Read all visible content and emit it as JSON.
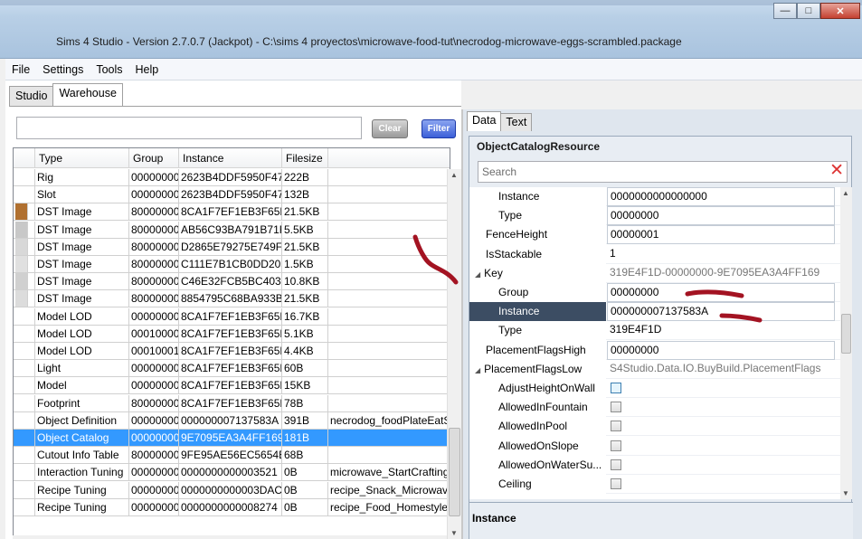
{
  "window": {
    "title": "Sims 4 Studio - Version 2.7.0.7  (Jackpot)   - C:\\sims 4 proyectos\\microwave-food-tut\\necrodog-microwave-eggs-scrambled.package"
  },
  "menu": [
    "File",
    "Settings",
    "Tools",
    "Help"
  ],
  "left_tabs": [
    "Studio",
    "Warehouse"
  ],
  "search": {
    "value": "",
    "clear_label": "Clear",
    "filter_label": "Filter"
  },
  "grid": {
    "columns": [
      "Type",
      "Group",
      "Instance",
      "Filesize"
    ],
    "rows": [
      {
        "type": "Rig",
        "group": "00000000",
        "instance": "2623B4DDF5950F47",
        "size": "222B",
        "name": ""
      },
      {
        "type": "Slot",
        "group": "00000000",
        "instance": "2623B4DDF5950F47",
        "size": "132B",
        "name": ""
      },
      {
        "type": "DST Image",
        "group": "80000000",
        "instance": "8CA1F7EF1EB3F65D",
        "size": "21.5KB",
        "name": ""
      },
      {
        "type": "DST Image",
        "group": "80000000",
        "instance": "AB56C93BA791B71F",
        "size": "5.5KB",
        "name": ""
      },
      {
        "type": "DST Image",
        "group": "80000000",
        "instance": "D2865E79275E749F",
        "size": "21.5KB",
        "name": ""
      },
      {
        "type": "DST Image",
        "group": "80000000",
        "instance": "C111E7B1CB0DD205",
        "size": "1.5KB",
        "name": ""
      },
      {
        "type": "DST Image",
        "group": "80000000",
        "instance": "C46E32FCB5BC403B",
        "size": "10.8KB",
        "name": ""
      },
      {
        "type": "DST Image",
        "group": "80000000",
        "instance": "8854795C68BA933B",
        "size": "21.5KB",
        "name": ""
      },
      {
        "type": "Model LOD",
        "group": "00000000",
        "instance": "8CA1F7EF1EB3F65D",
        "size": "16.7KB",
        "name": ""
      },
      {
        "type": "Model LOD",
        "group": "00010000",
        "instance": "8CA1F7EF1EB3F65D",
        "size": "5.1KB",
        "name": ""
      },
      {
        "type": "Model LOD",
        "group": "00010001",
        "instance": "8CA1F7EF1EB3F65D",
        "size": "4.4KB",
        "name": ""
      },
      {
        "type": "Light",
        "group": "00000000",
        "instance": "8CA1F7EF1EB3F65D",
        "size": "60B",
        "name": ""
      },
      {
        "type": "Model",
        "group": "00000000",
        "instance": "8CA1F7EF1EB3F65D",
        "size": "15KB",
        "name": ""
      },
      {
        "type": "Footprint",
        "group": "80000000",
        "instance": "8CA1F7EF1EB3F65D",
        "size": "78B",
        "name": ""
      },
      {
        "type": "Object Definition",
        "group": "00000000",
        "instance": "000000007137583A",
        "size": "391B",
        "name": "necrodog_foodPlateEatSin"
      },
      {
        "type": "Object Catalog",
        "group": "00000000",
        "instance": "9E7095EA3A4FF169",
        "size": "181B",
        "name": ""
      },
      {
        "type": "Cutout Info Table",
        "group": "80000000",
        "instance": "9FE95AE56EC5654E",
        "size": "68B",
        "name": ""
      },
      {
        "type": "Interaction Tuning",
        "group": "00000000",
        "instance": "0000000000003521",
        "size": "0B",
        "name": "microwave_StartCrafting"
      },
      {
        "type": "Recipe Tuning",
        "group": "00000000",
        "instance": "0000000000003DAC",
        "size": "0B",
        "name": "recipe_Snack_MicrowaveP"
      },
      {
        "type": "Recipe Tuning",
        "group": "00000000",
        "instance": "0000000000008274",
        "size": "0B",
        "name": "recipe_Food_Homestyle_S"
      }
    ]
  },
  "right_tabs": [
    "Data",
    "Text"
  ],
  "resource": {
    "heading": "ObjectCatalogResource",
    "search_placeholder": "Search",
    "props": [
      {
        "name": "Instance",
        "indent": 2,
        "value": "0000000000000000",
        "kind": "edit"
      },
      {
        "name": "Type",
        "indent": 2,
        "value": "00000000",
        "kind": "edit"
      },
      {
        "name": "FenceHeight",
        "indent": 1,
        "value": "00000001",
        "kind": "edit"
      },
      {
        "name": "IsStackable",
        "indent": 1,
        "value": "1",
        "kind": "text"
      },
      {
        "name": "Key",
        "indent": 0,
        "value": "319E4F1D-00000000-9E7095EA3A4FF169",
        "kind": "grey"
      },
      {
        "name": "Group",
        "indent": 2,
        "value": "00000000",
        "kind": "edit"
      },
      {
        "name": "Instance",
        "indent": 2,
        "value": "000000007137583A",
        "kind": "edit",
        "selected": true
      },
      {
        "name": "Type",
        "indent": 2,
        "value": "319E4F1D",
        "kind": "text"
      },
      {
        "name": "PlacementFlagsHigh",
        "indent": 1,
        "value": "00000000",
        "kind": "edit"
      },
      {
        "name": "PlacementFlagsLow",
        "indent": 0,
        "value": "S4Studio.Data.IO.BuyBuild.PlacementFlags",
        "kind": "grey"
      },
      {
        "name": "AdjustHeightOnWall",
        "indent": 2,
        "value": "",
        "kind": "check-focus"
      },
      {
        "name": "AllowedInFountain",
        "indent": 2,
        "value": "",
        "kind": "check"
      },
      {
        "name": "AllowedInPool",
        "indent": 2,
        "value": "",
        "kind": "check"
      },
      {
        "name": "AllowedOnSlope",
        "indent": 2,
        "value": "",
        "kind": "check"
      },
      {
        "name": "AllowedOnWaterSu...",
        "indent": 2,
        "value": "",
        "kind": "check"
      },
      {
        "name": "Ceiling",
        "indent": 2,
        "value": "",
        "kind": "check"
      }
    ],
    "description_title": "Instance"
  }
}
